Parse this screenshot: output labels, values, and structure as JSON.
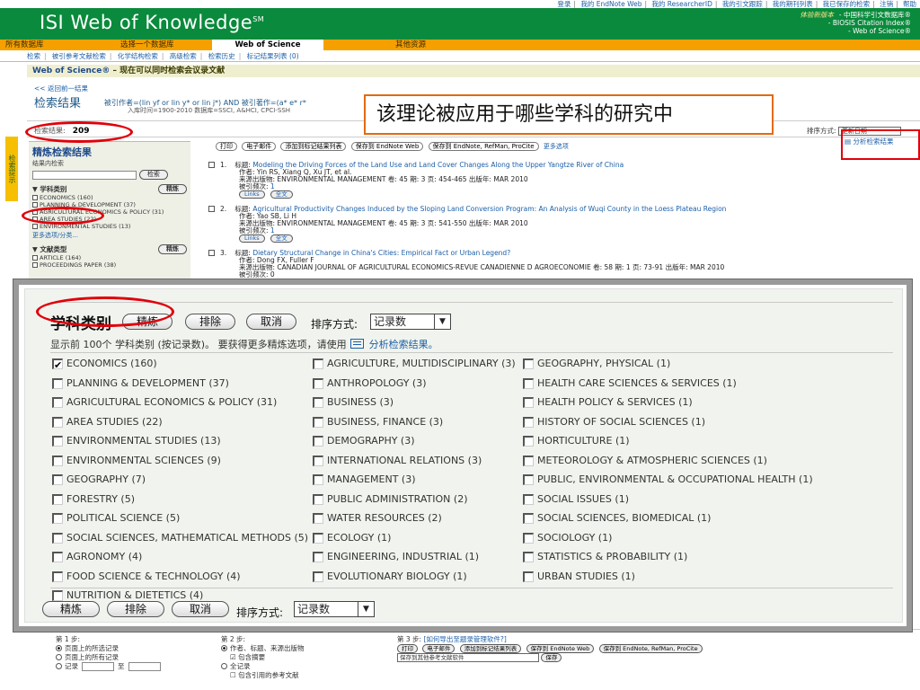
{
  "topnav": [
    "登录",
    "我的 EndNote Web",
    "我的 ResearcherID",
    "我的引文跟踪",
    "我的期刊列表",
    "我已保存的检索",
    "注销",
    "帮助"
  ],
  "header": {
    "logo": "ISI Web of Knowledge",
    "logo_mark": "SM",
    "new_version": "体验新版本",
    "brand_lines": [
      "- 中国科学引文数据库®",
      "- BIOSIS Citation Index®",
      "- Web of Science®"
    ]
  },
  "tabs": [
    "所有数据库",
    "选择一个数据库",
    "Web of Science",
    "其他资源"
  ],
  "subnav": [
    "检索",
    "被引参考文献检索",
    "化学结构检索",
    "高级检索",
    "检索历史",
    "标记结果列表 (0)"
  ],
  "wos_bar": {
    "name": "Web of Science®",
    "subtitle": " – 现在可以同时检索会议录文献"
  },
  "back_link": "<< 返回前一结果",
  "results_title": "检索结果",
  "query": "被引作者=(lin yf or lin y* or lin j*) AND 被引著作=(a* e* r*",
  "query_sub": "入库时间=1900-2010 数据库=SSCI, A&HCI, CPCI-SSH",
  "results_label": "检索结果:",
  "results_count": "209",
  "sort_label": "排序方式:",
  "sort_value": "更新日期",
  "analyze_link": "分析检索结果",
  "callout": "该理论被应用于哪些学科的研究中",
  "side_tab": "检索提示",
  "sidebar": {
    "title": "精炼检索结果",
    "search_within": "结果内检索",
    "search_button": "检索",
    "section1": "学科类别",
    "refine_button": "精炼",
    "items": [
      "ECONOMICS (160)",
      "PLANNING & DEVELOPMENT (37)",
      "AGRICULTURAL ECONOMICS & POLICY (31)",
      "AREA STUDIES (22)",
      "ENVIRONMENTAL STUDIES (13)"
    ],
    "more": "更多选项/分类...",
    "section2": "文献类型",
    "items2": [
      "ARTICLE (164)",
      "PROCEEDINGS PAPER (38)"
    ]
  },
  "rec_toolbar": [
    "打印",
    "电子邮件",
    "添加到标记结果列表",
    "保存到 EndNote Web",
    "保存到 EndNote, RefMan, ProCite"
  ],
  "rec_more": "更多选项",
  "records": [
    {
      "num": "1.",
      "title_label": "标题:",
      "title": "Modeling the Driving Forces of the Land Use and Land Cover Changes Along the Upper Yangtze River of China",
      "authors_label": "作者:",
      "authors": "Yin RS, Xiang Q, Xu JT, et al.",
      "source_label": "来源出版物:",
      "source": "ENVIRONMENTAL MANAGEMENT  卷: 45  期: 3  页: 454-465  出版年: MAR 2010",
      "cited_label": "被引频次:",
      "cited": "1"
    },
    {
      "num": "2.",
      "title_label": "标题:",
      "title": "Agricultural Productivity Changes Induced by the Sloping Land Conversion Program: An Analysis of Wuqi County in the Loess Plateau Region",
      "authors_label": "作者:",
      "authors": "Yao SB, Li H",
      "source_label": "来源出版物:",
      "source": "ENVIRONMENTAL MANAGEMENT  卷: 45  期: 3  页: 541-550  出版年: MAR 2010",
      "cited_label": "被引频次:",
      "cited": "1"
    },
    {
      "num": "3.",
      "title_label": "标题:",
      "title": "Dietary Structural Change in China's Cities: Empirical Fact or Urban Legend?",
      "authors_label": "作者:",
      "authors": "Dong FX, Fuller F",
      "source_label": "来源出版物:",
      "source": "CANADIAN JOURNAL OF AGRICULTURAL ECONOMICS-REVUE CANADIENNE D AGROECONOMIE  卷: 58  期: 1  页: 73-91  出版年: MAR 2010",
      "cited_label": "被引频次:",
      "cited": "0"
    }
  ],
  "links_label": "Links",
  "fulltext_label": "全文",
  "panel": {
    "title": "学科类别",
    "refine": "精炼",
    "exclude": "排除",
    "cancel": "取消",
    "sort_label": "排序方式:",
    "sort_value": "记录数",
    "hint_pre": "显示前 100个 学科类别 (按记录数)。 要获得更多精炼选项，请使用",
    "hint_link": "分析检索结果。",
    "columns": [
      [
        {
          "label": "ECONOMICS (160)",
          "checked": true
        },
        {
          "label": "PLANNING & DEVELOPMENT (37)",
          "checked": false
        },
        {
          "label": "AGRICULTURAL ECONOMICS & POLICY (31)",
          "checked": false
        },
        {
          "label": "AREA STUDIES (22)",
          "checked": false
        },
        {
          "label": "ENVIRONMENTAL STUDIES (13)",
          "checked": false
        },
        {
          "label": "ENVIRONMENTAL SCIENCES (9)",
          "checked": false
        },
        {
          "label": "GEOGRAPHY (7)",
          "checked": false
        },
        {
          "label": "FORESTRY (5)",
          "checked": false
        },
        {
          "label": "POLITICAL SCIENCE (5)",
          "checked": false
        },
        {
          "label": "SOCIAL SCIENCES, MATHEMATICAL METHODS (5)",
          "checked": false
        },
        {
          "label": "AGRONOMY (4)",
          "checked": false
        },
        {
          "label": "FOOD SCIENCE & TECHNOLOGY (4)",
          "checked": false
        },
        {
          "label": "NUTRITION & DIETETICS (4)",
          "checked": false
        }
      ],
      [
        {
          "label": "AGRICULTURE, MULTIDISCIPLINARY (3)",
          "checked": false
        },
        {
          "label": "ANTHROPOLOGY (3)",
          "checked": false
        },
        {
          "label": "BUSINESS (3)",
          "checked": false
        },
        {
          "label": "BUSINESS, FINANCE (3)",
          "checked": false
        },
        {
          "label": "DEMOGRAPHY (3)",
          "checked": false
        },
        {
          "label": "INTERNATIONAL RELATIONS (3)",
          "checked": false
        },
        {
          "label": "MANAGEMENT (3)",
          "checked": false
        },
        {
          "label": "PUBLIC ADMINISTRATION (2)",
          "checked": false
        },
        {
          "label": "WATER RESOURCES (2)",
          "checked": false
        },
        {
          "label": "ECOLOGY (1)",
          "checked": false
        },
        {
          "label": "ENGINEERING, INDUSTRIAL (1)",
          "checked": false
        },
        {
          "label": "EVOLUTIONARY BIOLOGY (1)",
          "checked": false
        }
      ],
      [
        {
          "label": "GEOGRAPHY, PHYSICAL (1)",
          "checked": false
        },
        {
          "label": "HEALTH CARE SCIENCES & SERVICES (1)",
          "checked": false
        },
        {
          "label": "HEALTH POLICY & SERVICES (1)",
          "checked": false
        },
        {
          "label": "HISTORY OF SOCIAL SCIENCES (1)",
          "checked": false
        },
        {
          "label": "HORTICULTURE (1)",
          "checked": false
        },
        {
          "label": "METEOROLOGY & ATMOSPHERIC SCIENCES (1)",
          "checked": false
        },
        {
          "label": "PUBLIC, ENVIRONMENTAL & OCCUPATIONAL HEALTH (1)",
          "checked": false
        },
        {
          "label": "SOCIAL ISSUES (1)",
          "checked": false
        },
        {
          "label": "SOCIAL SCIENCES, BIOMEDICAL (1)",
          "checked": false
        },
        {
          "label": "SOCIOLOGY (1)",
          "checked": false
        },
        {
          "label": "STATISTICS & PROBABILITY (1)",
          "checked": false
        },
        {
          "label": "URBAN STUDIES (1)",
          "checked": false
        }
      ]
    ]
  },
  "bottom": {
    "step1": "第 1 步:",
    "step1_opts": [
      "页面上的所选记录",
      "页面上的所有记录",
      "记录"
    ],
    "step1_to": "至",
    "step2": "第 2 步:",
    "step2_opts": [
      "作者、标题、来源出版物",
      "包含摘要",
      "全记录",
      "包含引用的参考文献"
    ],
    "step3": "第 3 步:",
    "step3_link": "[如何导出至题录管理软件?]",
    "step3_buttons": [
      "打印",
      "电子邮件",
      "添加到标记结果列表",
      "保存到 EndNote Web",
      "保存到 EndNote, RefMan, ProCite"
    ],
    "step3_select": "保存到其他参考文献软件",
    "step3_save": "保存"
  }
}
